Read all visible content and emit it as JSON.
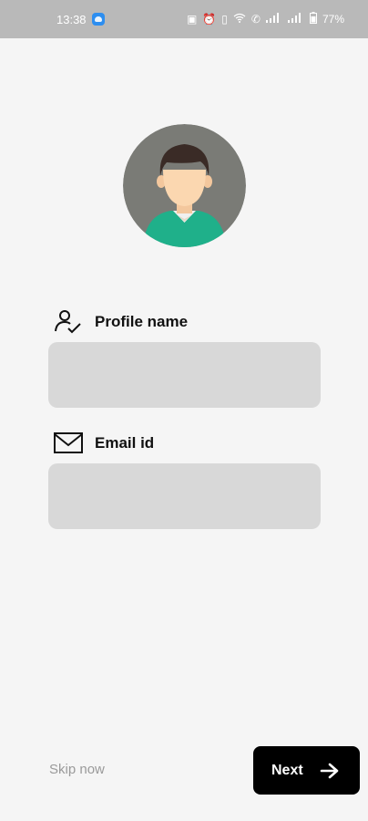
{
  "status_bar": {
    "time": "13:38",
    "battery": "77%"
  },
  "form": {
    "profile_name_label": "Profile name",
    "profile_name_value": "",
    "email_label": "Email id",
    "email_value": ""
  },
  "actions": {
    "skip_label": "Skip now",
    "next_label": "Next"
  },
  "icons": {
    "profile": "user-check-icon",
    "email": "mail-icon",
    "next": "arrow-right-icon"
  },
  "colors": {
    "background": "#f5f5f5",
    "input": "#d8d8d8",
    "primary_button": "#000000",
    "avatar_circle": "#7a7b76",
    "shirt": "#1fb08a"
  }
}
